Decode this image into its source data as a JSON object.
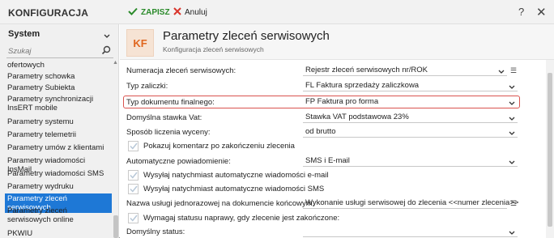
{
  "app": {
    "title": "KONFIGURACJA"
  },
  "toolbar": {
    "save_label": "ZAPISZ",
    "cancel_label": "Anuluj",
    "help_label": "?",
    "close_label": "✕"
  },
  "sidebar": {
    "system_select": "System",
    "search_placeholder": "Szukaj",
    "items": [
      {
        "label": "ofertowych",
        "active": false
      },
      {
        "label": "Parametry schowka",
        "active": false
      },
      {
        "label": "Parametry Subiekta",
        "active": false
      },
      {
        "label": "Parametry synchronizacji InsERT mobile",
        "active": false
      },
      {
        "label": "Parametry systemu",
        "active": false
      },
      {
        "label": "Parametry telemetrii",
        "active": false
      },
      {
        "label": "Parametry umów z klientami",
        "active": false
      },
      {
        "label": "Parametry wiadomości InsMail",
        "active": false
      },
      {
        "label": "Parametry wiadomości SMS",
        "active": false
      },
      {
        "label": "Parametry wydruku",
        "active": false
      },
      {
        "label": "Parametry zleceń serwisowych",
        "active": true
      },
      {
        "label": "Parametry zleceń serwisowych online",
        "active": false
      },
      {
        "label": "PKWIU",
        "active": false
      }
    ]
  },
  "header": {
    "badge": "KF",
    "title": "Parametry zleceń serwisowych",
    "subtitle": "Konfiguracja zleceń serwisowych"
  },
  "form": {
    "numeracja": {
      "label": "Numeracja zleceń serwisowych:",
      "value": "Rejestr zleceń serwisowych nr/ROK"
    },
    "typ_zaliczki": {
      "label": "Typ zaliczki:",
      "value": "FL  Faktura sprzedaży zaliczkowa"
    },
    "typ_dokumentu": {
      "label": "Typ dokumentu finalnego:",
      "value": "FP  Faktura pro forma"
    },
    "stawka_vat": {
      "label": "Domyślna stawka Vat:",
      "value": "Stawka VAT podstawowa 23%"
    },
    "sposob_liczenia": {
      "label": "Sposób liczenia wyceny:",
      "value": "od brutto"
    },
    "pokazuj_komentarz": {
      "label": "Pokazuj komentarz po zakończeniu zlecenia"
    },
    "powiadomienie": {
      "label": "Automatyczne powiadomienie:",
      "value": "SMS i E-mail"
    },
    "wysylaj_email": {
      "label": "Wysyłaj natychmiast automatyczne wiadomości e-mail"
    },
    "wysylaj_sms": {
      "label": "Wysyłaj natychmiast automatyczne wiadomości SMS"
    },
    "nazwa_uslugi": {
      "label": "Nazwa usługi jednorazowej na dokumencie końcowym:",
      "value": "Wykonanie usługi serwisowej do zlecenia <<numer zlecenia>>"
    },
    "wymagaj_statusu": {
      "label": "Wymagaj statusu naprawy, gdy zlecenie jest zakończone:"
    },
    "domyslny_status": {
      "label": "Domyślny status:",
      "value": ""
    }
  },
  "colors": {
    "accent": "#1e78d6",
    "save": "#2a8a2a",
    "highlight": "#d9534f",
    "badge": "#e0661f"
  }
}
